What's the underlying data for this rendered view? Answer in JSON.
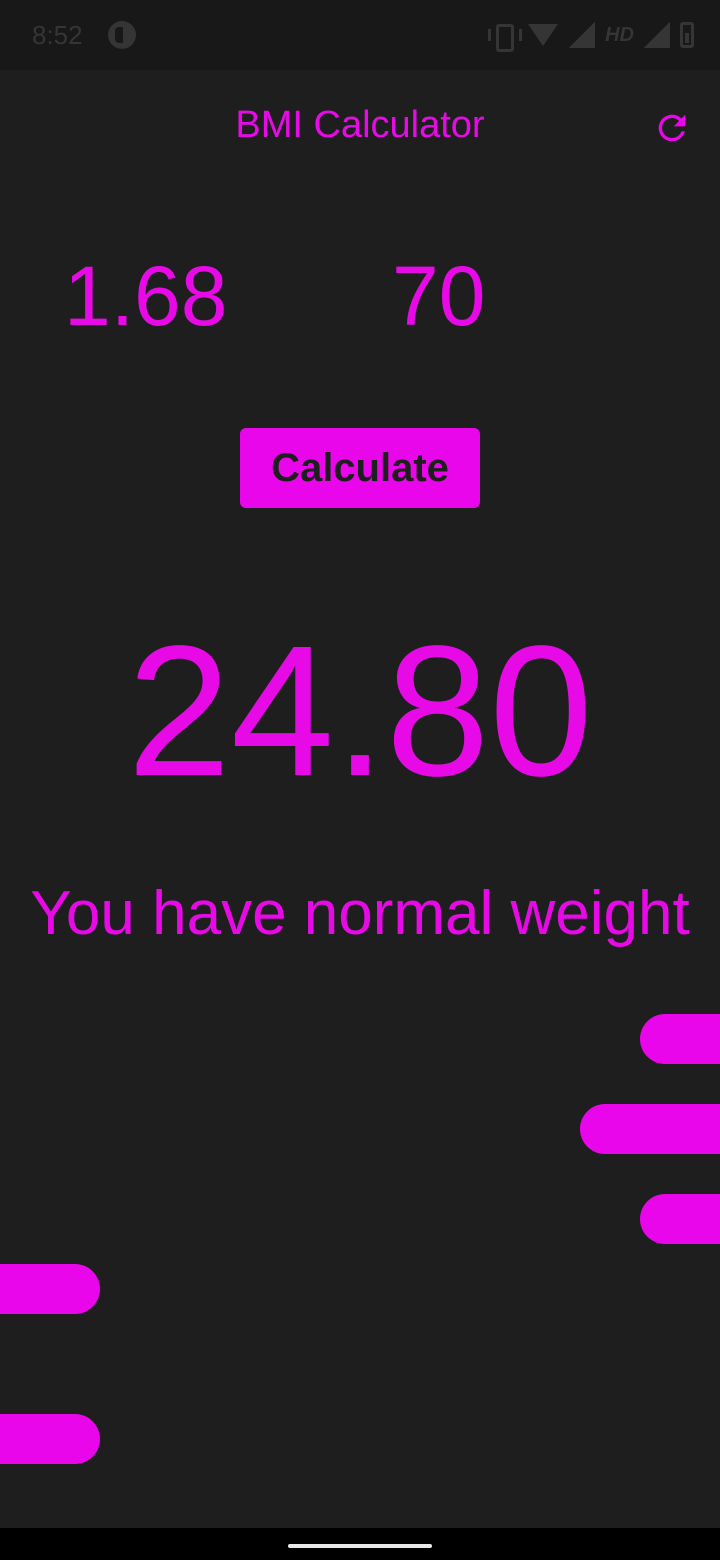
{
  "status_bar": {
    "time": "8:52",
    "hd_label": "HD"
  },
  "app": {
    "title": "BMI Calculator",
    "refresh_icon": "refresh-icon"
  },
  "inputs": {
    "height_value": "1.68",
    "weight_value": "70"
  },
  "actions": {
    "calculate_label": "Calculate"
  },
  "result": {
    "bmi_value": "24.80",
    "message": "You have normal weight"
  },
  "colors": {
    "accent": "#ea06ea",
    "background": "#1e1e1e",
    "status_bar": "#181818"
  }
}
